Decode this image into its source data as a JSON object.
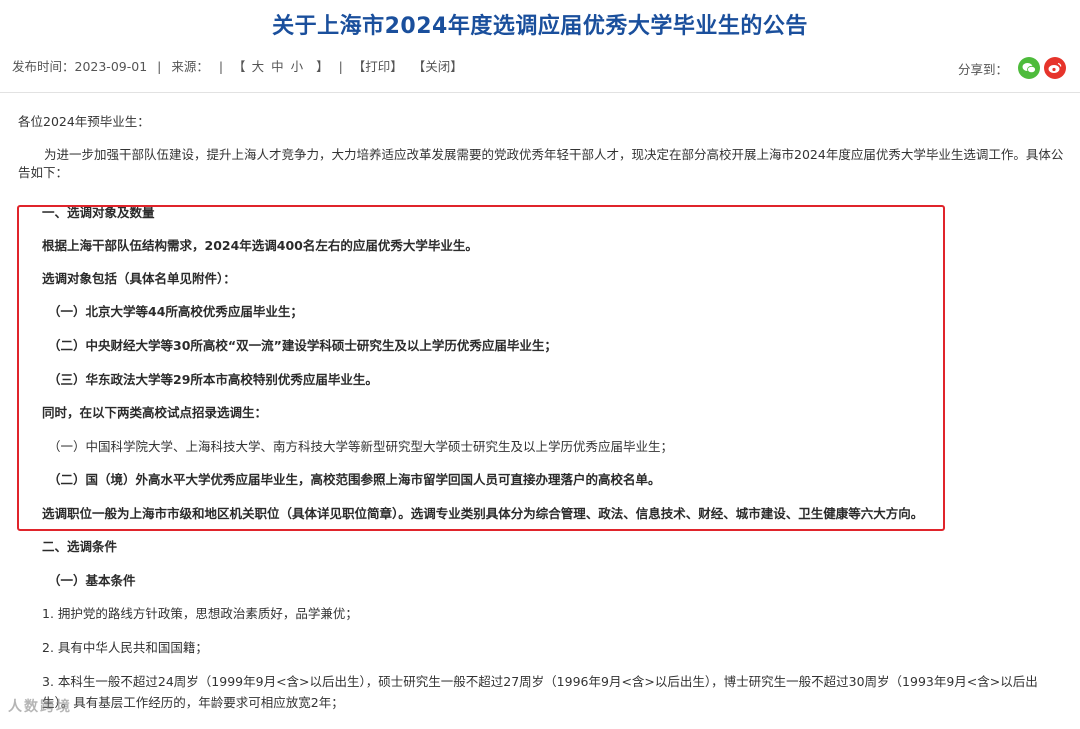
{
  "article": {
    "title": "关于上海市2024年度选调应届优秀大学毕业生的公告",
    "meta": {
      "publish_label": "发布时间：2023-09-01",
      "sep1": "|",
      "source_label": "来源：",
      "sep2": "|",
      "font_bracket_open": "【",
      "font_sizes": "大中小",
      "font_bracket_close": "】",
      "sep3": "|",
      "print": "【打印】",
      "close": "【关闭】"
    },
    "share": {
      "label": "分享到：",
      "wechat_icon": "wechat-icon",
      "weibo_icon": "weibo-icon"
    },
    "paragraphs": [
      "各位2024年预毕业生：",
      "为进一步加强干部队伍建设，提升上海人才竞争力，大力培养适应改革发展需要的党政优秀年轻干部人才，现决定在部分高校开展上海市2024年度应届优秀大学毕业生选调工作。具体公告如下：",
      "一、选调对象及数量",
      "根据上海干部队伍结构需求，2024年选调400名左右的应届优秀大学毕业生。",
      "选调对象包括（具体名单见附件）：",
      "（一）北京大学等44所高校优秀应届毕业生；",
      "（二）中央财经大学等30所高校“双一流”建设学科硕士研究生及以上学历优秀应届毕业生；",
      "（三）华东政法大学等29所本市高校特别优秀应届毕业生。",
      "同时，在以下两类高校试点招录选调生：",
      "（一）中国科学院大学、上海科技大学、南方科技大学等新型研究型大学硕士研究生及以上学历优秀应届毕业生；",
      "（二）国（境）外高水平大学优秀应届毕业生，高校范围参照上海市留学回国人员可直接办理落户的高校名单。",
      "选调职位一般为上海市市级和地区机关职位（具体详见职位简章）。选调专业类别具体分为综合管理、政法、信息技术、财经、城市建设、卫生健康等六大方向。",
      "二、选调条件",
      "（一）基本条件",
      "1. 拥护党的路线方针政策，思想政治素质好，品学兼优；",
      "2. 具有中华人民共和国国籍；",
      "3. 本科生一般不超过24周岁（1999年9月<含>以后出生），硕士研究生一般不超过27周岁（1996年9月<含>以后出生），博士研究生一般不超过30周岁（1993年9月<含>以后出",
      "生）。具有基层工作经历的，年龄要求可相应放宽2年；"
    ],
    "colors": {
      "title": "#1a4f9c",
      "highlight_border": "#e0242b",
      "wechat": "#4dbb3b",
      "weibo": "#e6342b"
    }
  },
  "watermark": "人数跨境"
}
